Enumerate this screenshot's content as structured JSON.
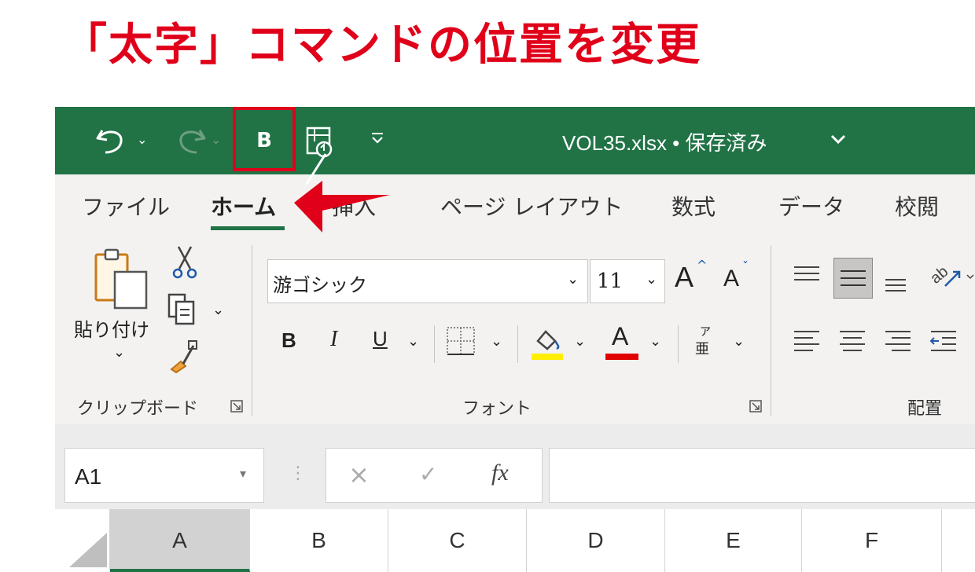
{
  "headline": "「太字」コマンドの位置を変更",
  "colors": {
    "brand_green": "#217346",
    "highlight_red": "#e0001a"
  },
  "quick_access": {
    "undo_icon": "undo-icon",
    "redo_icon": "redo-icon",
    "bold_label": "B",
    "refresh_icon": "refresh-all-icon",
    "customize_icon": "customize-qat-icon"
  },
  "document": {
    "title": "VOL35.xlsx • 保存済み"
  },
  "tabs": [
    {
      "label": "ファイル"
    },
    {
      "label": "ホーム"
    },
    {
      "label": "挿入"
    },
    {
      "label": "ページ レイアウト"
    },
    {
      "label": "数式"
    },
    {
      "label": "データ"
    },
    {
      "label": "校閲"
    }
  ],
  "clipboard": {
    "paste_label": "貼り付け",
    "group_label": "クリップボード"
  },
  "font": {
    "font_name": "游ゴシック",
    "font_size": "11",
    "bold": "B",
    "italic": "I",
    "underline": "U",
    "font_color_letter": "A",
    "grow_letter": "A",
    "shrink_letter": "A",
    "phonetic_top": "ア",
    "phonetic_bottom": "亜",
    "group_label": "フォント",
    "highlight_color": "#ffee00",
    "font_color": "#e00000"
  },
  "alignment": {
    "group_label": "配置"
  },
  "formula_bar": {
    "name_box": "A1",
    "fx": "fx"
  },
  "columns": [
    "A",
    "B",
    "C",
    "D",
    "E",
    "F"
  ]
}
